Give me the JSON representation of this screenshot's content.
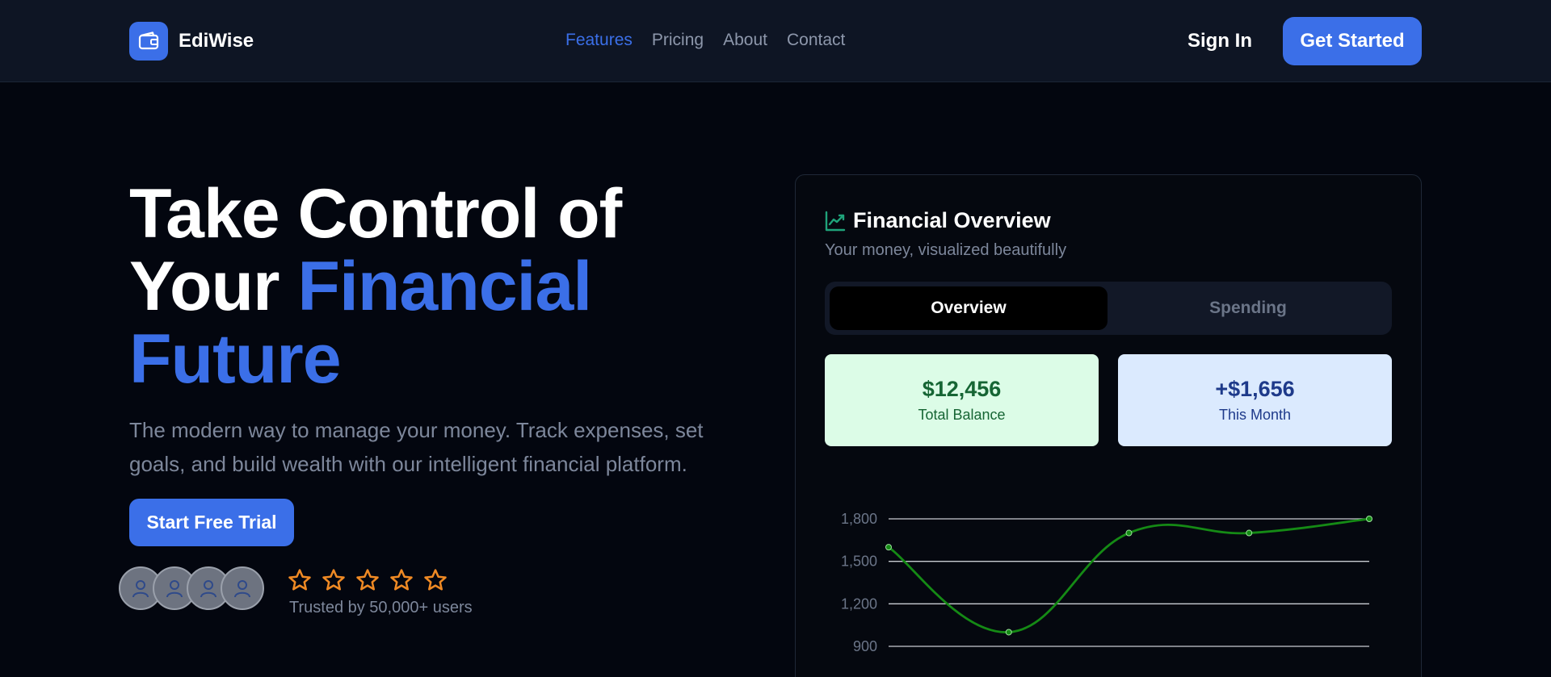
{
  "nav": {
    "brand": "EdiWise",
    "links": [
      {
        "label": "Features",
        "active": true
      },
      {
        "label": "Pricing",
        "active": false
      },
      {
        "label": "About",
        "active": false
      },
      {
        "label": "Contact",
        "active": false
      }
    ],
    "sign_in": "Sign In",
    "get_started": "Get Started"
  },
  "hero": {
    "title_line1": "Take Control of",
    "title_line2_plain": "Your ",
    "title_line2_accent": "Financial",
    "title_line3_accent": "Future",
    "description": "The modern way to manage your money. Track expenses, set goals, and build wealth with our intelligent financial platform.",
    "cta": "Start Free Trial",
    "trusted": "Trusted by 50,000+ users",
    "avatar_count": 4,
    "star_count": 5
  },
  "card": {
    "title": "Financial Overview",
    "subtitle": "Your money, visualized beautifully",
    "tabs": [
      {
        "label": "Overview",
        "active": true
      },
      {
        "label": "Spending",
        "active": false
      }
    ],
    "stats": [
      {
        "value": "$12,456",
        "label": "Total Balance"
      },
      {
        "value": "+$1,656",
        "label": "This Month"
      }
    ]
  },
  "colors": {
    "accent": "#3b6fe8",
    "line": "#158a15",
    "star": "#f08a24",
    "chart_icon": "#1fa37a"
  },
  "chart_data": {
    "type": "line",
    "x": [
      1,
      2,
      3,
      4,
      5
    ],
    "series": [
      {
        "values": [
          1600,
          1000,
          1700,
          1700,
          1800
        ]
      }
    ],
    "y_ticks": [
      900,
      1200,
      1500,
      1800
    ],
    "y_tick_labels": [
      "900",
      "1,200",
      "1,500",
      "1,800"
    ],
    "ylim": [
      900,
      1800
    ],
    "grid": true,
    "smooth": true
  }
}
